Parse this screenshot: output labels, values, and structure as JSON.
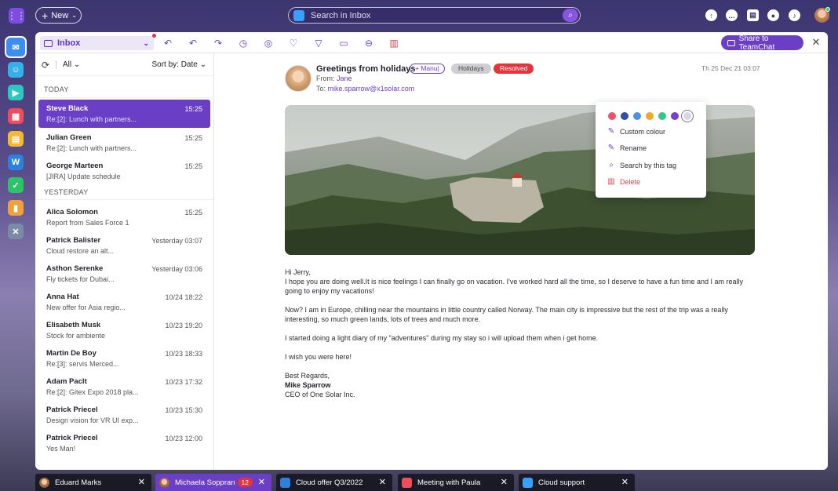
{
  "topbar": {
    "new_label": "New",
    "search_placeholder": "Search in Inbox"
  },
  "toolbar": {
    "folder": "Inbox",
    "share_label": "Share to TeamChat"
  },
  "list": {
    "filter": "All",
    "sort": "Sort by: Date",
    "sections": {
      "today": "TODAY",
      "yesterday": "YESTERDAY"
    },
    "messages": [
      {
        "name": "Steve Black",
        "subject": "Re:[2]: Lunch with partners...",
        "time": "15:25",
        "selected": true
      },
      {
        "name": "Julian Green",
        "subject": "Re:[2]: Lunch with partners...",
        "time": "15:25"
      },
      {
        "name": "George Marteen",
        "subject": "[JIRA] Update schedule",
        "time": "15:25"
      },
      {
        "name": "Alica Solomon",
        "subject": "Report from Sales Force 1",
        "time": "15:25"
      },
      {
        "name": "Patrick Balister",
        "subject": "Cloud restore an alt...",
        "time": "Yesterday 03:07"
      },
      {
        "name": "Asthon Serenke",
        "subject": "Fly tickets for Dubai...",
        "time": "Yesterday 03:06"
      },
      {
        "name": "Anna Hat",
        "subject": "New offer for Asia regio...",
        "time": "10/24 18:22"
      },
      {
        "name": "Elisabeth Musk",
        "subject": "Stock for ambiente",
        "time": "10/23 19:20"
      },
      {
        "name": "Martin De Boy",
        "subject": "Re:[3]: servis Merced...",
        "time": "10/23 18:33"
      },
      {
        "name": "Adam Paclt",
        "subject": "Re:[2]: Gitex Expo 2018 pla...",
        "time": "10/23 17:32"
      },
      {
        "name": "Patrick Priecel",
        "subject": "Design vision for VR UI exp...",
        "time": "10/23 15:30"
      },
      {
        "name": "Patrick Priecel",
        "subject": "Yes Man!",
        "time": "10/23 12:00"
      }
    ]
  },
  "reader": {
    "subject": "Greetings from holidays",
    "tags": {
      "manual": "+ Manu|",
      "holidays": "Holidays",
      "resolved": "Resolved"
    },
    "from_label": "From:",
    "from": "Jane",
    "to_label": "To:",
    "to": "mike.sparrow@x1solar.com",
    "date": "Th 25 Dec 21 03:07",
    "body": {
      "greeting": "Hi Jerry,",
      "p1": "I hope you are doing well.It is nice feelings I can finally go on vacation. I've worked hard all the time, so I deserve to have a fun time and I am really going to enjoy my vacations!",
      "p2": "Now? I am in Europe, chilling near the mountains in little country called Norway. The main city is impressive but the rest of the trip was a really interesting, so much green lands, lots of trees and much more.",
      "p3": "I started doing a light diary of my \"adventures\" during my stay so i will upload them when i get home.",
      "p4": "I wish you were here!",
      "closing": "Best Regards,",
      "sig_name": "Mike Sparrow",
      "sig_title": "CEO of One Solar Inc."
    }
  },
  "tag_menu": {
    "swatches": [
      "#f0506e",
      "#2f4fa8",
      "#4d8ef0",
      "#f5a623",
      "#2ecc8a",
      "#7a3fd0",
      "#d9d4e8"
    ],
    "custom": "Custom colour",
    "rename": "Rename",
    "search": "Search by this tag",
    "delete": "Delete"
  },
  "taskbar": [
    {
      "label": "Eduard Marks"
    },
    {
      "label": "Michaela Soppran",
      "badge": "12",
      "active": true
    },
    {
      "label": "Cloud offer Q3/2022"
    },
    {
      "label": "Meeting with Paula"
    },
    {
      "label": "Cloud support"
    }
  ],
  "colors": {
    "accent": "#6a3fc6",
    "danger": "#e5333b"
  }
}
